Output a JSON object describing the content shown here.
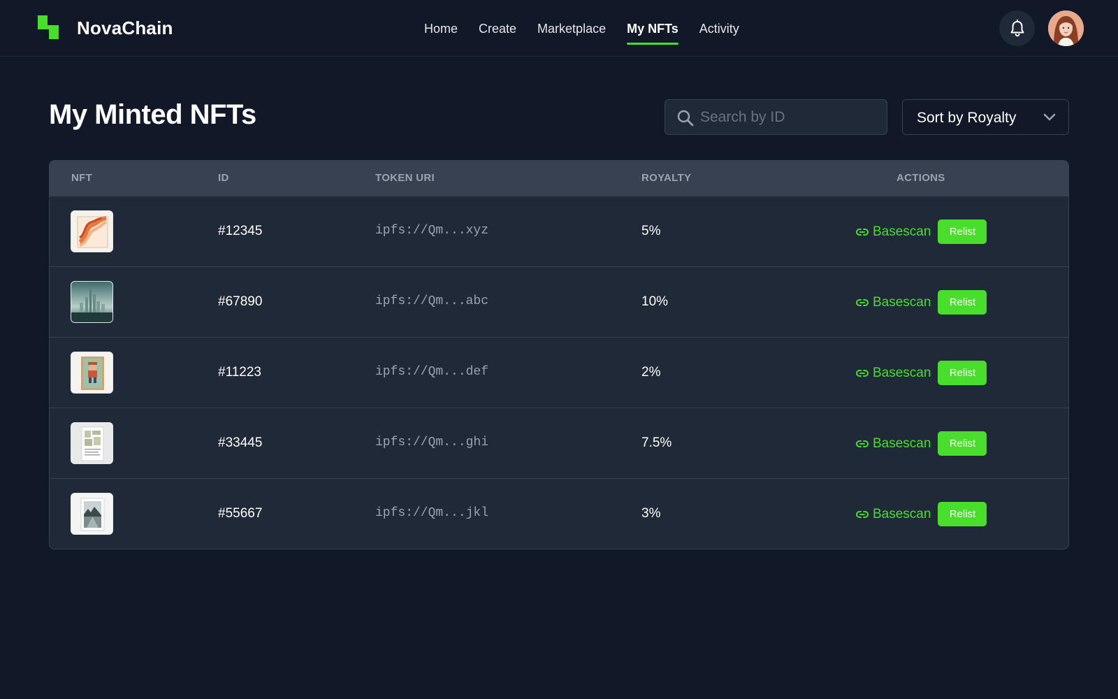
{
  "brand": {
    "name": "NovaChain"
  },
  "nav": {
    "items": [
      {
        "label": "Home"
      },
      {
        "label": "Create"
      },
      {
        "label": "Marketplace"
      },
      {
        "label": "My NFTs",
        "active": true
      },
      {
        "label": "Activity"
      }
    ]
  },
  "header": {
    "bell_icon": "bell-icon",
    "avatar": "user-avatar"
  },
  "page": {
    "title": "My Minted NFTs"
  },
  "search": {
    "placeholder": "Search by ID",
    "value": ""
  },
  "sort": {
    "selected": "Sort by Royalty"
  },
  "table": {
    "columns": [
      "NFT",
      "ID",
      "TOKEN URI",
      "ROYALTY",
      "ACTIONS"
    ],
    "rows": [
      {
        "id": "#12345",
        "uri": "ipfs://Qm...xyz",
        "royalty": "5%",
        "link": "Basescan",
        "button": "Relist",
        "thumb": "abstract-waves"
      },
      {
        "id": "#67890",
        "uri": "ipfs://Qm...abc",
        "royalty": "10%",
        "link": "Basescan",
        "button": "Relist",
        "thumb": "city-skyline"
      },
      {
        "id": "#11223",
        "uri": "ipfs://Qm...def",
        "royalty": "2%",
        "link": "Basescan",
        "button": "Relist",
        "thumb": "pixel-character"
      },
      {
        "id": "#33445",
        "uri": "ipfs://Qm...ghi",
        "royalty": "7.5%",
        "link": "Basescan",
        "button": "Relist",
        "thumb": "document-page"
      },
      {
        "id": "#55667",
        "uri": "ipfs://Qm...jkl",
        "royalty": "3%",
        "link": "Basescan",
        "button": "Relist",
        "thumb": "lake-landscape"
      }
    ]
  },
  "colors": {
    "accent": "#4ade2c",
    "background": "#111827",
    "surface": "#1f2937",
    "border": "#374151"
  }
}
